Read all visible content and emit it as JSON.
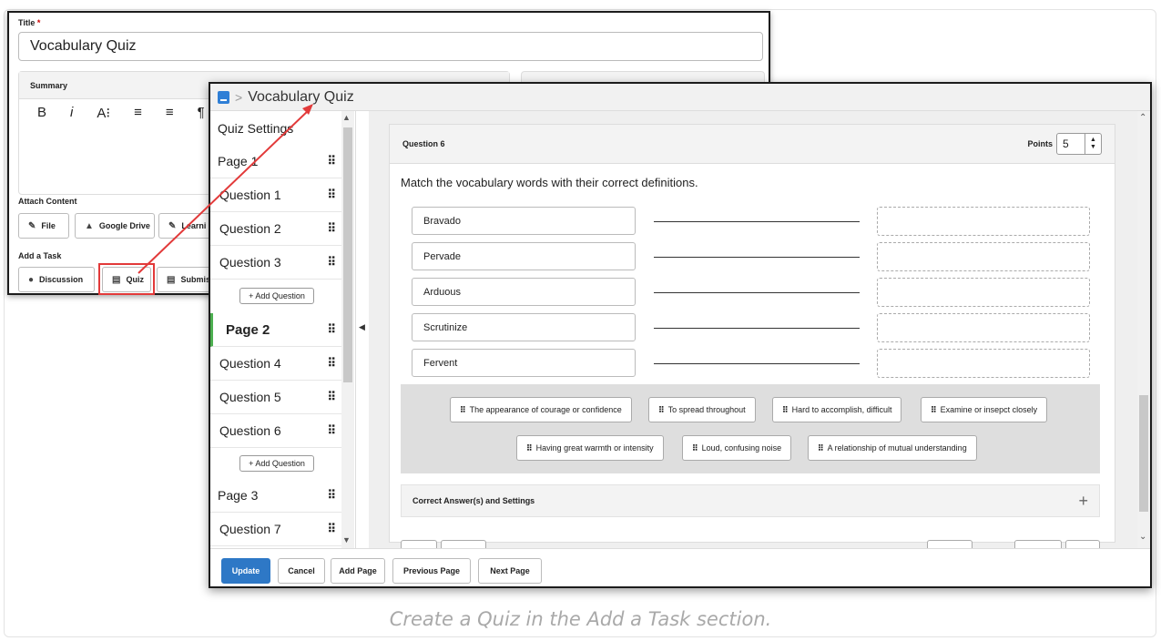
{
  "caption": "Create a Quiz in the Add a Task section.",
  "colors": {
    "accent": "#2e78c6",
    "highlight": "#e23a3a",
    "active_marker": "#4caf50"
  },
  "back_panel": {
    "title_label": "Title",
    "title_required": "*",
    "title_value": "Vocabulary Quiz",
    "summary_label": "Summary",
    "toolbar": [
      "B",
      "i",
      "A⁝",
      "≡",
      "≡",
      "¶"
    ],
    "attach_content_label": "Attach Content",
    "attach_buttons": [
      {
        "label": "File",
        "icon": "paperclip-icon"
      },
      {
        "label": "Google Drive",
        "icon": "google-drive-icon"
      },
      {
        "label": "Learni",
        "icon": "link-icon"
      }
    ],
    "add_task_label": "Add a Task",
    "task_buttons": [
      {
        "label": "Discussion",
        "icon": "discussion-icon"
      },
      {
        "label": "Quiz",
        "icon": "quiz-icon"
      },
      {
        "label": "Submis",
        "icon": "submission-icon"
      }
    ]
  },
  "front_window": {
    "breadcrumb_separator": ">",
    "breadcrumb_title": "Vocabulary Quiz",
    "sidebar": {
      "items": [
        {
          "label": "Quiz Settings",
          "kind": "settings"
        },
        {
          "label": "Page 1",
          "kind": "page"
        },
        {
          "label": "Question 1",
          "kind": "question"
        },
        {
          "label": "Question 2",
          "kind": "question"
        },
        {
          "label": "Question 3",
          "kind": "question"
        },
        {
          "label": "+ Add Question",
          "kind": "add"
        },
        {
          "label": "Page 2",
          "kind": "page-active"
        },
        {
          "label": "Question 4",
          "kind": "question"
        },
        {
          "label": "Question 5",
          "kind": "question"
        },
        {
          "label": "Question 6",
          "kind": "question"
        },
        {
          "label": "+ Add Question",
          "kind": "add"
        },
        {
          "label": "Page 3",
          "kind": "page"
        },
        {
          "label": "Question 7",
          "kind": "question"
        }
      ]
    },
    "question": {
      "title": "Question 6",
      "points_label": "Points",
      "points_value": "5",
      "prompt": "Match the vocabulary words with their correct definitions.",
      "terms": [
        "Bravado",
        "Pervade",
        "Arduous",
        "Scrutinize",
        "Fervent"
      ],
      "answer_bank": [
        "The appearance of courage or confidence",
        "To spread throughout",
        "Hard to accomplish, difficult",
        "Examine or insepct closely",
        "Having great warmth or intensity",
        "Loud, confusing noise",
        "A relationship of mutual understanding"
      ],
      "correct_settings_label": "Correct Answer(s) and Settings",
      "expand_symbol": "+"
    },
    "footer_buttons": [
      "Update",
      "Cancel",
      "Add Page",
      "Previous Page",
      "Next Page"
    ]
  }
}
